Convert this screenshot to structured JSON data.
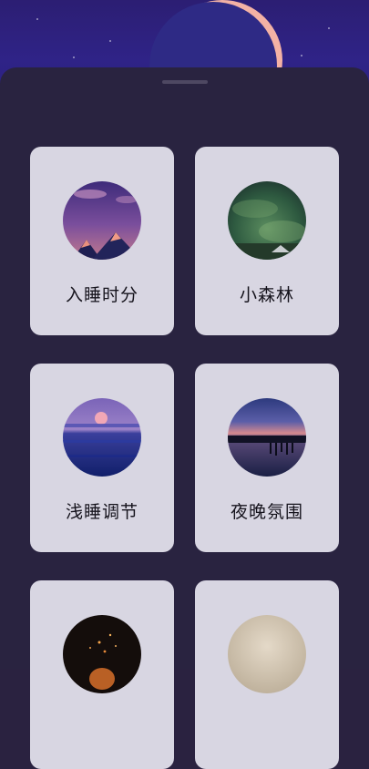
{
  "cards": [
    {
      "label": "入睡时分",
      "image": "sleep-dusk-mountain-image"
    },
    {
      "label": "小森林",
      "image": "forest-aurora-image"
    },
    {
      "label": "浅睡调节",
      "image": "sunset-ocean-image"
    },
    {
      "label": "夜晚氛围",
      "image": "night-lake-pier-image"
    },
    {
      "label": "",
      "image": "campfire-sparks-image"
    },
    {
      "label": "",
      "image": "misty-beige-image"
    }
  ],
  "colors": {
    "background": "#292340",
    "card": "#d8d6e2",
    "hero": "#2c1e73",
    "moon_edge": "#f3b2a5"
  }
}
